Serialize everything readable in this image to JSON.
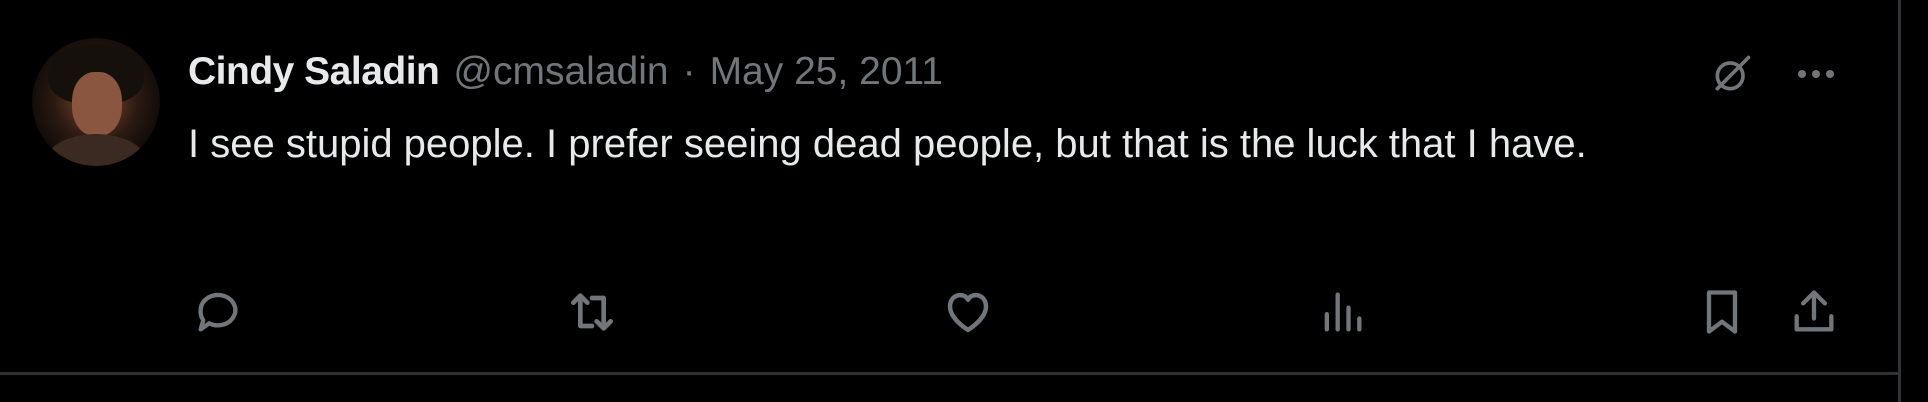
{
  "tweet": {
    "author_name": "Cindy Saladin",
    "handle": "@cmsaladin",
    "separator": "·",
    "date": "May 25, 2011",
    "text": "I see stupid people. I prefer seeing dead people, but that is the luck that I have."
  },
  "icons": {
    "grok": "grok-icon",
    "more": "more-icon",
    "reply": "reply-icon",
    "repost": "repost-icon",
    "like": "like-icon",
    "views": "views-icon",
    "bookmark": "bookmark-icon",
    "share": "share-icon"
  },
  "colors": {
    "background": "#000000",
    "text_primary": "#e7e9ea",
    "text_secondary": "#71767b",
    "border": "#2f3336"
  }
}
